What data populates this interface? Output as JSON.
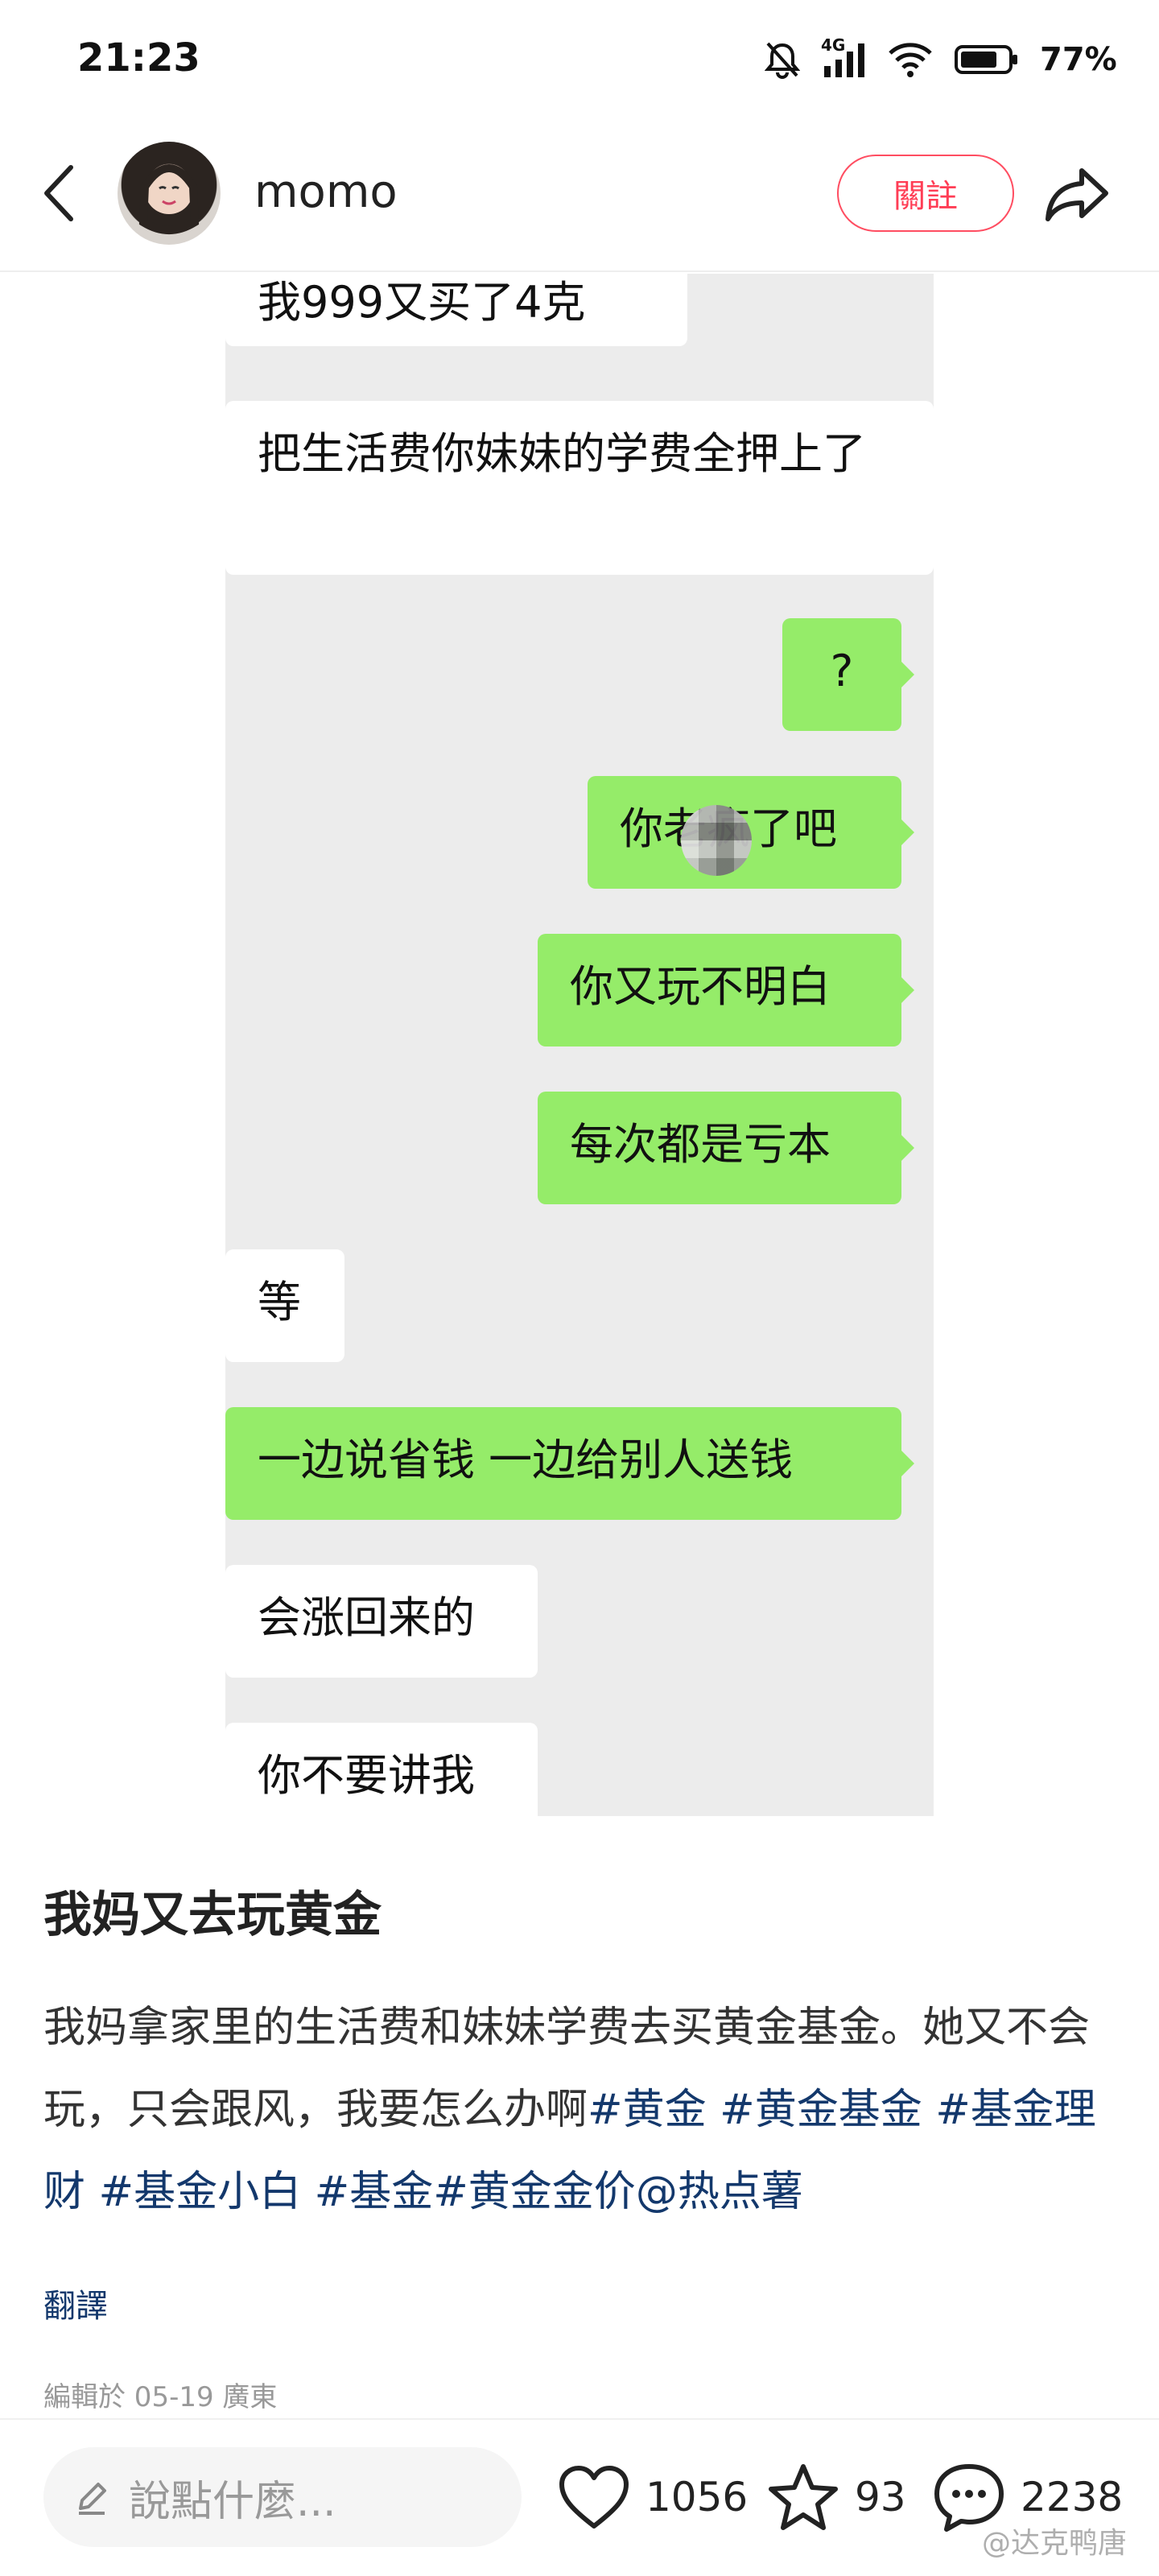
{
  "status_bar": {
    "time": "21:23",
    "network": "4G",
    "battery": "77%",
    "icons": [
      "mute-bell-icon",
      "signal-icon",
      "wifi-icon",
      "battery-icon"
    ]
  },
  "header": {
    "username": "momo",
    "follow_label": "關註",
    "icons": [
      "back-arrow-icon",
      "share-icon"
    ]
  },
  "chat": {
    "messages": [
      {
        "side": "left",
        "text": "我999又买了4克"
      },
      {
        "side": "left",
        "text": "把生活费你妹妹的学费全押上了"
      },
      {
        "side": "right",
        "text": "?"
      },
      {
        "side": "right",
        "text": "你老疯了吧"
      },
      {
        "side": "right",
        "text": "你又玩不明白"
      },
      {
        "side": "right",
        "text": "每次都是亏本"
      },
      {
        "side": "left",
        "text": "等"
      },
      {
        "side": "right",
        "text": "一边说省钱 一边给别人送钱"
      },
      {
        "side": "left",
        "text": "会涨回来的"
      },
      {
        "side": "left",
        "text": "你不要讲我"
      }
    ]
  },
  "post": {
    "title": "我妈又去玩黄金",
    "body_text": "我妈拿家里的生活费和妹妹学费去买黄金基金。她又不会玩，只会跟风，我要怎么办啊",
    "tags": [
      "#黄金",
      "#黄金基金",
      "#基金理财",
      "#基金小白",
      "#基金",
      "#黄金金价",
      "@热点薯"
    ],
    "translate_label": "翻譯",
    "edit_meta": "編輯於 05-19 廣東"
  },
  "bottom_bar": {
    "comment_placeholder": "說點什麼...",
    "likes": "1056",
    "favorites": "93",
    "comments": "2238"
  },
  "watermark": "@达克鸭唐",
  "colors": {
    "accent_red": "#ff3d55",
    "bubble_green": "#95ec69",
    "tag_blue": "#13386c",
    "chat_background": "#ececec"
  }
}
